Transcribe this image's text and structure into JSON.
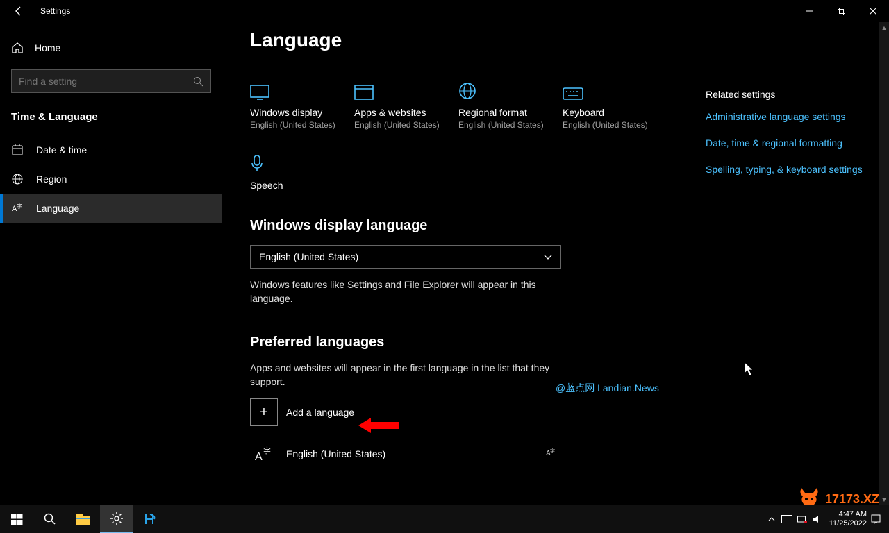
{
  "titlebar": {
    "title": "Settings"
  },
  "sidebar": {
    "home": "Home",
    "search_placeholder": "Find a setting",
    "section": "Time & Language",
    "items": [
      {
        "label": "Date & time"
      },
      {
        "label": "Region"
      },
      {
        "label": "Language"
      }
    ]
  },
  "page": {
    "title": "Language",
    "cards": [
      {
        "title": "Windows display",
        "sub": "English (United States)"
      },
      {
        "title": "Apps & websites",
        "sub": "English (United States)"
      },
      {
        "title": "Regional format",
        "sub": "English (United States)"
      },
      {
        "title": "Keyboard",
        "sub": "English (United States)"
      },
      {
        "title": "Speech",
        "sub": ""
      }
    ],
    "display_lang_heading": "Windows display language",
    "display_lang_value": "English (United States)",
    "display_lang_help": "Windows features like Settings and File Explorer will appear in this language.",
    "preferred_heading": "Preferred languages",
    "preferred_help": "Apps and websites will appear in the first language in the list that they support.",
    "add_label": "Add a language",
    "installed": [
      {
        "label": "English (United States)"
      }
    ]
  },
  "related": {
    "heading": "Related settings",
    "links": [
      "Administrative language settings",
      "Date, time & regional formatting",
      "Spelling, typing, & keyboard settings"
    ]
  },
  "watermark": "@蓝点网 Landian.News",
  "logo_text": "17173.XZ",
  "taskbar": {
    "time": "4:47 AM",
    "date": "11/25/2022"
  }
}
